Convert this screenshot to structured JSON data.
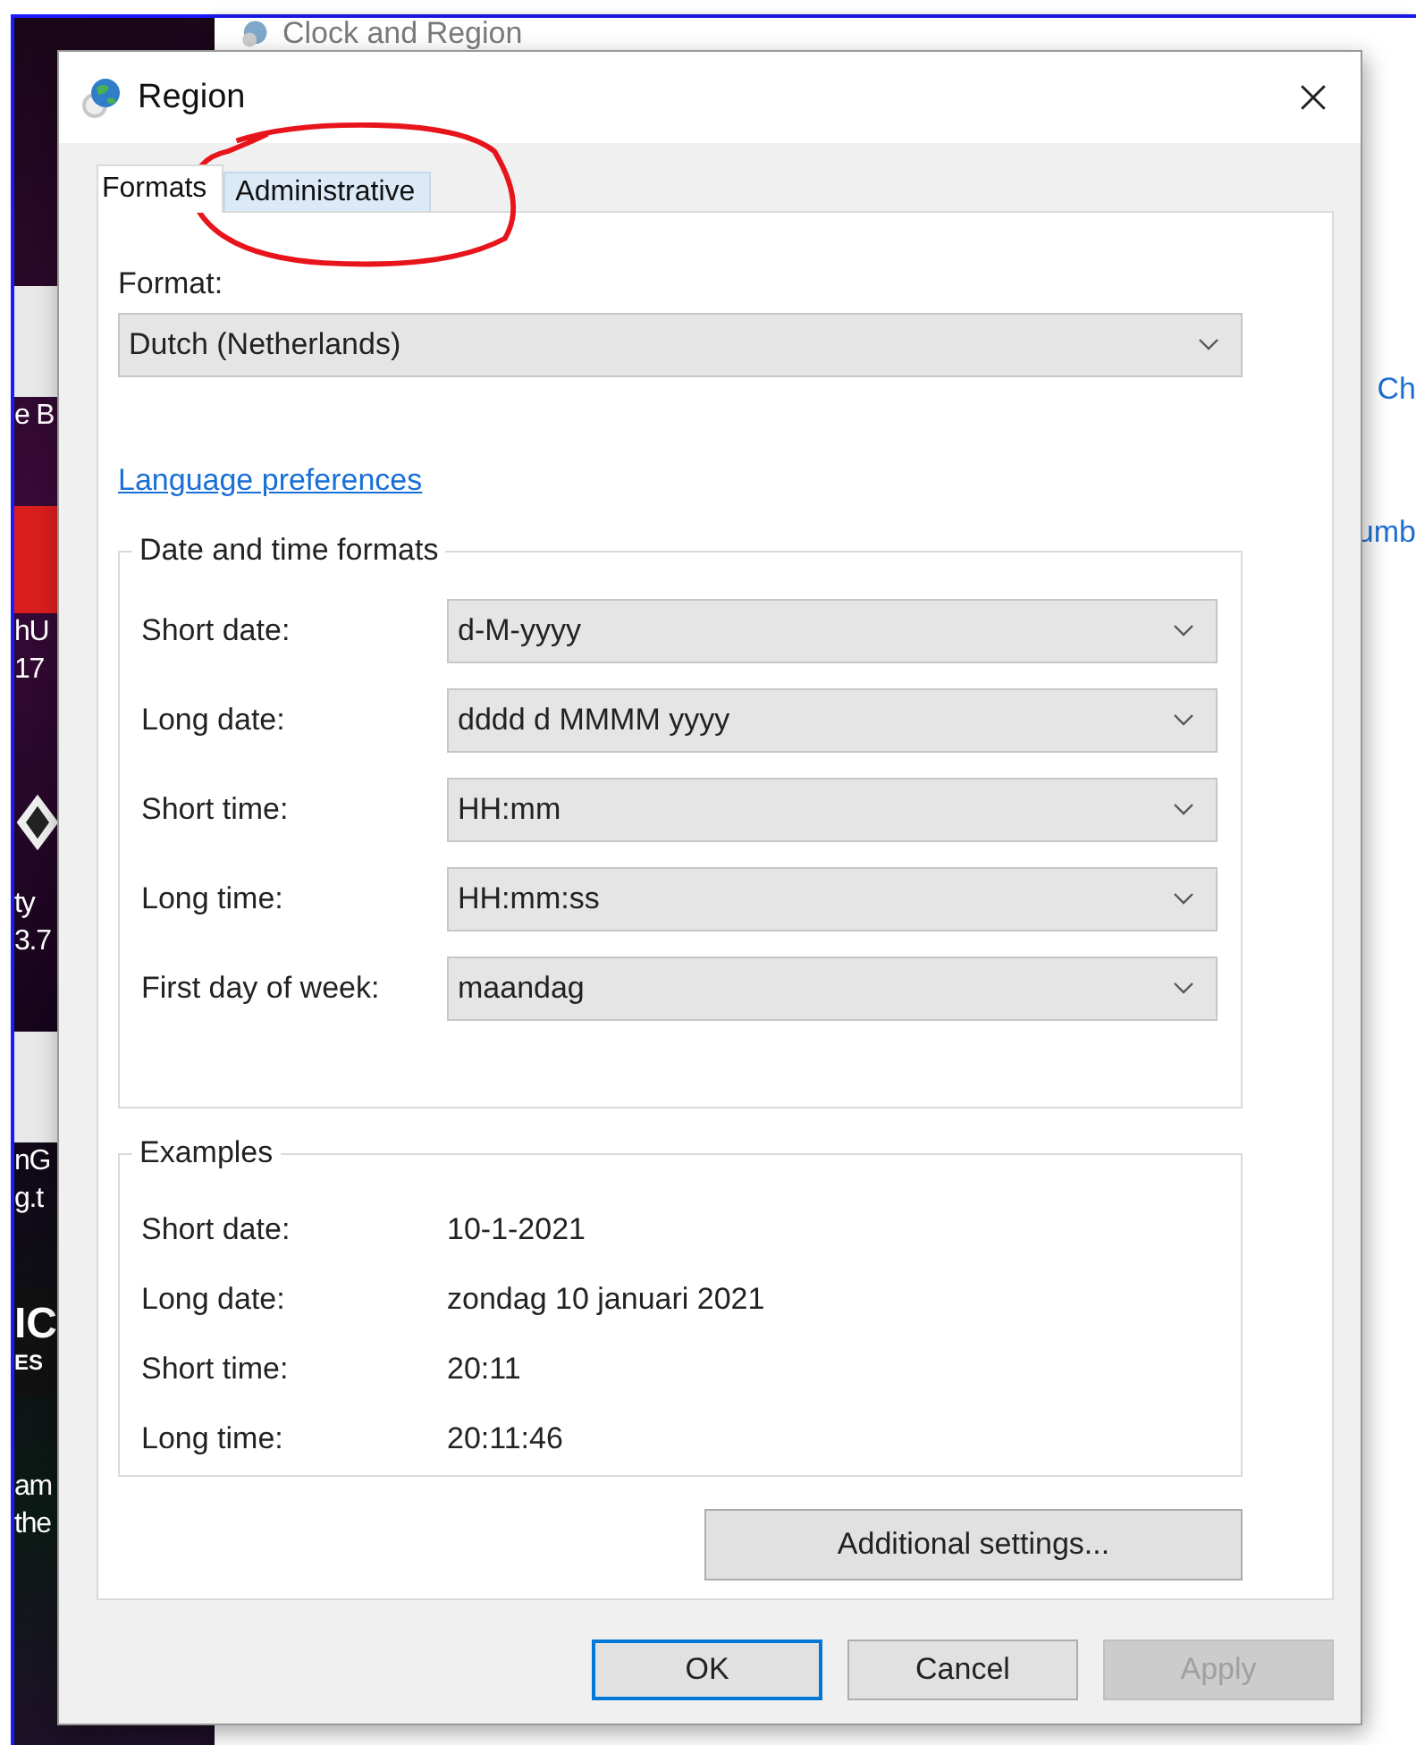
{
  "background_window": {
    "title": "Clock and Region",
    "links": [
      "Ch",
      "umb"
    ]
  },
  "desktop_icons": [
    {
      "kind": "document",
      "lines": [
        "e B"
      ]
    },
    {
      "kind": "app",
      "lines": [
        "hU",
        "17"
      ]
    },
    {
      "kind": "unity",
      "lines": [
        "ty",
        "3.7"
      ]
    },
    {
      "kind": "document",
      "lines": [
        "nG",
        "g.t"
      ]
    },
    {
      "kind": "logo",
      "lines": [
        "IC",
        "ES"
      ]
    },
    {
      "kind": "none",
      "lines": [
        "am",
        "the"
      ]
    }
  ],
  "dialog": {
    "title": "Region",
    "tabs": [
      {
        "label": "Formats",
        "selected": true
      },
      {
        "label": "Administrative",
        "selected": false
      }
    ],
    "format_label": "Format:",
    "format_value": "Dutch (Netherlands)",
    "link": "Language preferences",
    "date_time_formats": {
      "title": "Date and time formats",
      "rows": [
        {
          "label": "Short date:",
          "value": "d-M-yyyy"
        },
        {
          "label": "Long date:",
          "value": "dddd d MMMM yyyy"
        },
        {
          "label": "Short time:",
          "value": "HH:mm"
        },
        {
          "label": "Long time:",
          "value": "HH:mm:ss"
        },
        {
          "label": "First day of week:",
          "value": "maandag"
        }
      ]
    },
    "examples": {
      "title": "Examples",
      "rows": [
        {
          "label": "Short date:",
          "value": "10-1-2021"
        },
        {
          "label": "Long date:",
          "value": "zondag 10 januari 2021"
        },
        {
          "label": "Short time:",
          "value": "20:11"
        },
        {
          "label": "Long time:",
          "value": "20:11:46"
        }
      ]
    },
    "additional_button": "Additional settings...",
    "buttons": [
      {
        "label": "OK",
        "kind": "default",
        "disabled": false
      },
      {
        "label": "Cancel",
        "kind": "normal",
        "disabled": false
      },
      {
        "label": "Apply",
        "kind": "normal",
        "disabled": true
      }
    ]
  },
  "annotations": [
    {
      "kind": "ellipse"
    }
  ]
}
